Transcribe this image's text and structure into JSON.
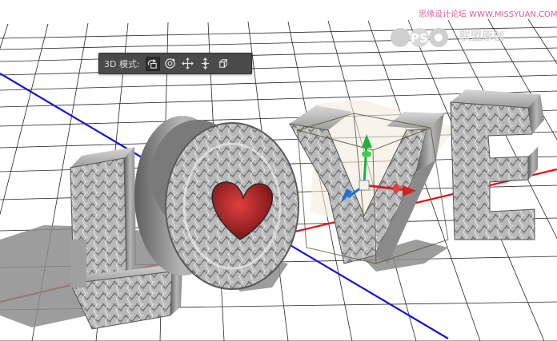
{
  "watermark": {
    "url_text": "思缘设计论坛 WWW.MISSYUAN.COM",
    "logo_letters": "PS",
    "brand_text": "联盟原创",
    "color": "#e05a9b"
  },
  "toolbar": {
    "label": "3D 模式:",
    "tools": [
      {
        "icon": "rotate-3d-icon",
        "active": true
      },
      {
        "icon": "roll-3d-icon",
        "active": false
      },
      {
        "icon": "drag-3d-icon",
        "active": false
      },
      {
        "icon": "slide-3d-icon",
        "active": false
      },
      {
        "icon": "scale-3d-icon",
        "active": false
      }
    ]
  },
  "scene": {
    "letters": [
      "L",
      "O",
      "V",
      "E"
    ],
    "grid_color": "#000000",
    "axis_colors": {
      "x": "#e01010",
      "z": "#1515d0"
    },
    "gizmo_colors": {
      "x": "#d42020",
      "y": "#20b040",
      "z": "#1f6fd0"
    }
  }
}
